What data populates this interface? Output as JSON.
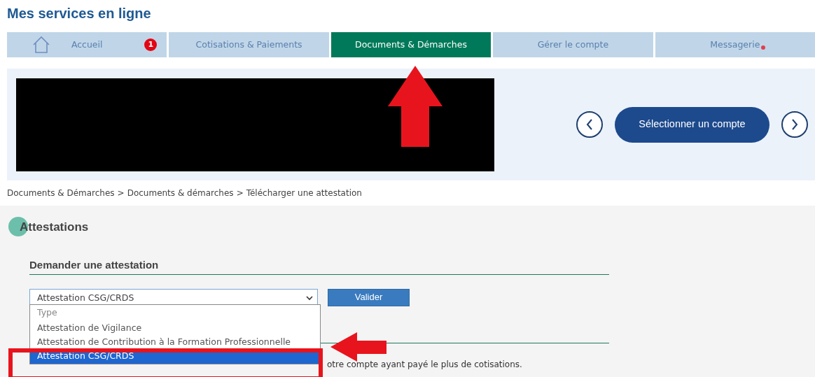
{
  "header": {
    "title": "Mes services en ligne"
  },
  "tabs": [
    {
      "label": "Accueil",
      "selected": false,
      "kind": "home",
      "badge": "1",
      "unread": false
    },
    {
      "label": "Cotisations & Paiements",
      "selected": false,
      "kind": "plain",
      "unread": false
    },
    {
      "label": "Documents & Démarches",
      "selected": true,
      "kind": "plain",
      "unread": false
    },
    {
      "label": "Gérer le compte",
      "selected": false,
      "kind": "plain",
      "unread": false
    },
    {
      "label": "Messagerie",
      "selected": false,
      "kind": "plain",
      "unread": true
    }
  ],
  "account_bar": {
    "select_button": "Sélectionner un compte"
  },
  "breadcrumb": {
    "separator": ">",
    "items": [
      "Documents & Démarches",
      "Documents & démarches",
      "Télécharger une attestation"
    ]
  },
  "section": {
    "title": "Attestations",
    "subtitle": "Demander une attestation",
    "select": {
      "value": "Attestation CSG/CRDS",
      "options": [
        {
          "label": "Type",
          "selected": false
        },
        {
          "label": "Attestation de Vigilance",
          "selected": false
        },
        {
          "label": "Attestation de Contribution à la Formation Professionnelle",
          "selected": false
        },
        {
          "label": "Attestation CSG/CRDS",
          "selected": true
        }
      ]
    },
    "submit": "Valider",
    "note": "otre compte ayant payé le plus de cotisations."
  }
}
